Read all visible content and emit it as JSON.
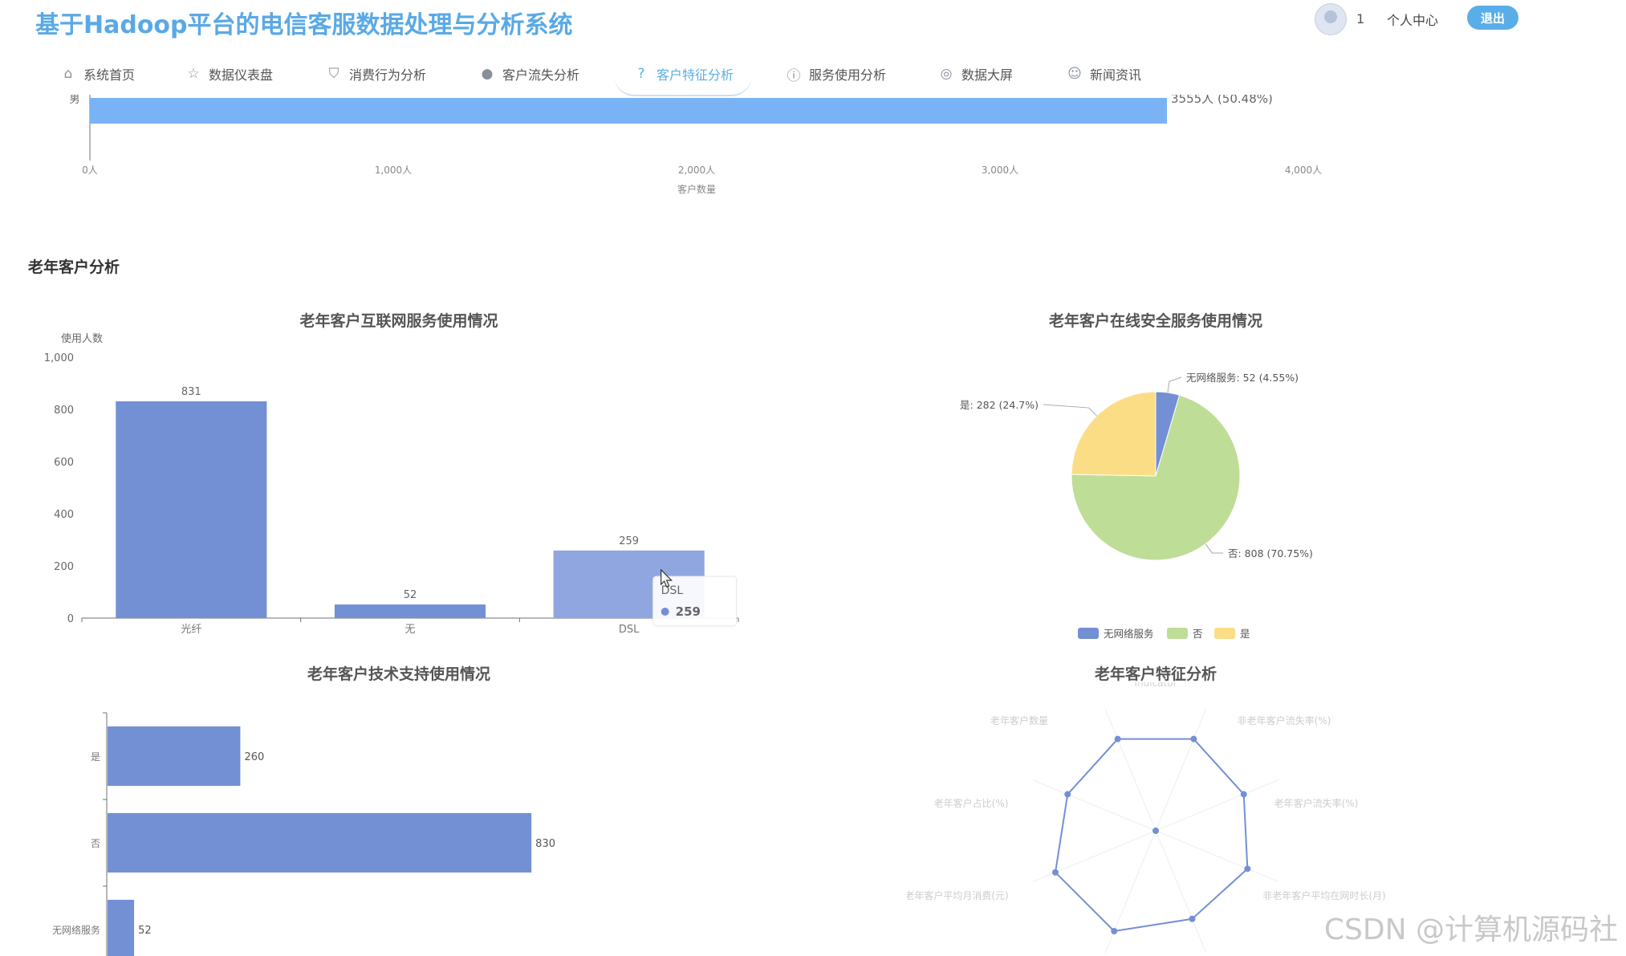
{
  "header": {
    "app_title": "基于Hadoop平台的电信客服数据处理与分析系统",
    "user_id": "1",
    "profile_label": "个人中心",
    "logout_label": "退出"
  },
  "nav": {
    "items": [
      {
        "label": "系统首页",
        "icon": "home-icon"
      },
      {
        "label": "数据仪表盘",
        "icon": "star-icon"
      },
      {
        "label": "消费行为分析",
        "icon": "bag-icon"
      },
      {
        "label": "客户流失分析",
        "icon": "alert-icon"
      },
      {
        "label": "客户特征分析",
        "icon": "question-icon",
        "active": true
      },
      {
        "label": "服务使用分析",
        "icon": "info-icon"
      },
      {
        "label": "数据大屏",
        "icon": "screen-icon"
      },
      {
        "label": "新闻资讯",
        "icon": "news-icon"
      }
    ]
  },
  "top_chart": {
    "category_label": "男",
    "bar_label": "3555人 (50.48%)",
    "axis_title": "客户数量",
    "ticks": [
      "0人",
      "1,000人",
      "2,000人",
      "3,000人",
      "4,000人"
    ]
  },
  "section": {
    "title": "老年客户分析"
  },
  "chart_data": [
    {
      "type": "bar",
      "title": "老年客户互联网服务使用情况",
      "ylabel": "使用人数",
      "categories": [
        "光纤",
        "无",
        "DSL"
      ],
      "values": [
        831,
        52,
        259
      ],
      "ylim": [
        0,
        1000
      ],
      "yticks": [
        "0",
        "200",
        "400",
        "600",
        "800",
        "1,000"
      ],
      "tooltip": {
        "name": "DSL",
        "value": "259"
      },
      "color": "#7390d4"
    },
    {
      "type": "pie",
      "title": "老年客户在线安全服务使用情况",
      "slices": [
        {
          "name": "无网络服务",
          "value": 52,
          "label": "无网络服务: 52 (4.55%)",
          "color": "#7390d4"
        },
        {
          "name": "否",
          "value": 808,
          "label": "否: 808 (70.75%)",
          "color": "#bedd96"
        },
        {
          "name": "是",
          "value": 282,
          "label": "是: 282 (24.7%)",
          "color": "#fbdd86"
        }
      ],
      "legend": [
        "无网络服务",
        "否",
        "是"
      ],
      "legend_position": "bottom"
    },
    {
      "type": "bar",
      "orientation": "horizontal",
      "title": "老年客户技术支持使用情况",
      "categories": [
        "是",
        "否",
        "无网络服务"
      ],
      "values": [
        260,
        830,
        52
      ],
      "color": "#7390d4"
    },
    {
      "type": "radar",
      "title": "老年客户特征分析",
      "legend": [
        "Indicator"
      ],
      "indicators": [
        "老年客户数量",
        "非老年客户流失率(%)",
        "老年客户流失率(%)",
        "非老年客户平均在网时长(月)",
        "",
        "",
        "老年客户平均月消费(元)",
        "老年客户占比(%)"
      ],
      "values": [
        0.75,
        0.72,
        0.75,
        0.72,
        0.82,
        0.82,
        0.72,
        0.75
      ]
    }
  ],
  "watermark": "CSDN @计算机源码社"
}
